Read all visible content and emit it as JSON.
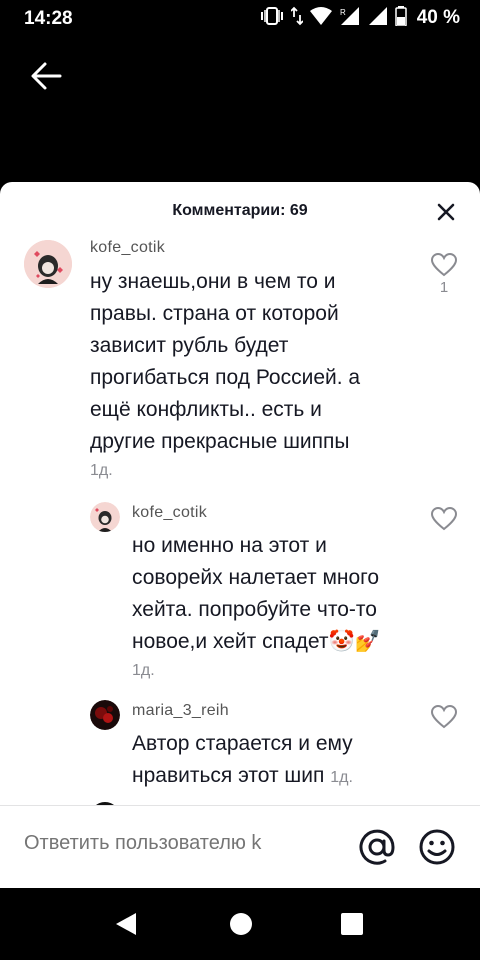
{
  "status_bar": {
    "time": "14:28",
    "battery": "40 %",
    "icons": [
      "vibrate-icon",
      "data-arrows-icon",
      "wifi-icon",
      "signal-icon",
      "signal-icon",
      "battery-icon"
    ]
  },
  "sheet": {
    "title": "Комментарии: 69",
    "close_icon": "close-icon"
  },
  "comments": [
    {
      "username": "kofe_cotik",
      "text_lines": [
        "ну знаешь,они в чем то и",
        "правы. страна от которой",
        "зависит рубль будет",
        "прогибаться под Россией. а",
        "ещё конфликты.. есть и",
        "другие прекрасные шиппы"
      ],
      "time": "1д.",
      "likes": "1"
    },
    {
      "username": "kofe_cotik",
      "text_lines": [
        "но именно на этот и",
        "соворейх налетает много",
        "хейта. попробуйте что-то",
        "новое,и хейт спадет🤡💅"
      ],
      "time": "1д."
    },
    {
      "username": "maria_3_reih",
      "text_lines": [
        "Автор старается и ему",
        "нравиться этот шип"
      ],
      "time": "1д."
    }
  ],
  "reply": {
    "placeholder": "Ответить пользователю k"
  },
  "colors": {
    "text": "#161823",
    "muted": "#8a8b91",
    "background": "#ffffff"
  }
}
